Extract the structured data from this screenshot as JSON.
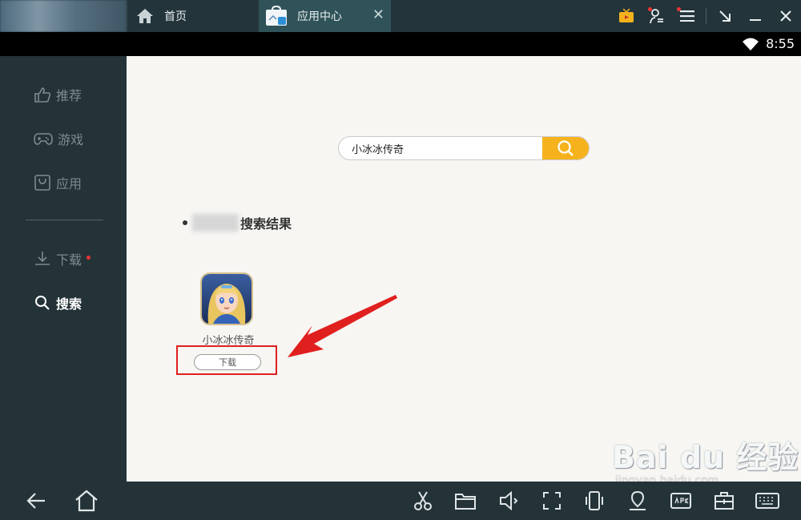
{
  "tabs": {
    "home_label": "首页",
    "app_center_label": "应用中心",
    "close_glyph": "✕"
  },
  "status": {
    "time": "8:55"
  },
  "sidebar": {
    "items": [
      {
        "label": "推荐",
        "icon": "thumbs-up-icon"
      },
      {
        "label": "游戏",
        "icon": "gamepad-icon"
      },
      {
        "label": "应用",
        "icon": "app-bag-icon"
      },
      {
        "label": "下载",
        "icon": "download-icon"
      },
      {
        "label": "搜索",
        "icon": "search-icon"
      }
    ]
  },
  "search": {
    "value": "小冰冰传奇"
  },
  "results": {
    "title": "搜索结果",
    "app_name": "小冰冰传奇",
    "download_label": "下载"
  },
  "watermark": {
    "line1": "Bai du 经验",
    "line2": "jingyan.baidu.com"
  },
  "colors": {
    "search_button": "#f6b21c",
    "highlight": "#e0201f",
    "sidebar_bg": "#243338"
  }
}
